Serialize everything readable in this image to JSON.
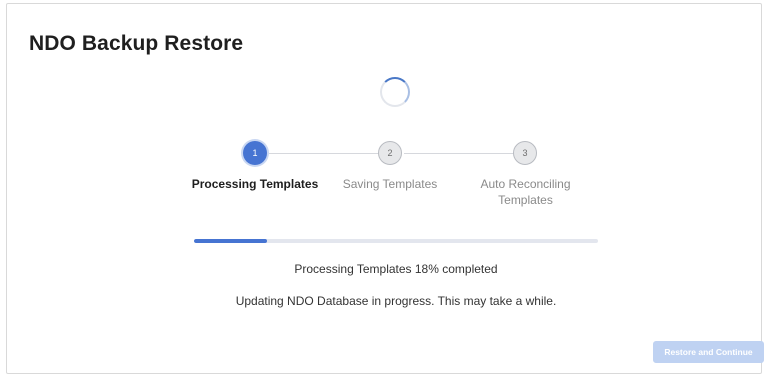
{
  "dialog": {
    "title": "NDO Backup Restore"
  },
  "steps": [
    {
      "number": "1",
      "label": "Processing Templates",
      "status": "active"
    },
    {
      "number": "2",
      "label": "Saving Templates",
      "status": "pending"
    },
    {
      "number": "3",
      "label": "Auto Reconciling Templates",
      "status": "pending"
    }
  ],
  "progress": {
    "percent": 18,
    "status_text": "Processing Templates 18% completed",
    "info_text": "Updating NDO Database in progress. This may take a while."
  },
  "actions": {
    "restore_label": "Restore and Continue",
    "restore_enabled": false
  },
  "colors": {
    "accent": "#4674d2",
    "disabled_button": "#bfd2f2",
    "inactive_step": "#e7e8ea"
  }
}
